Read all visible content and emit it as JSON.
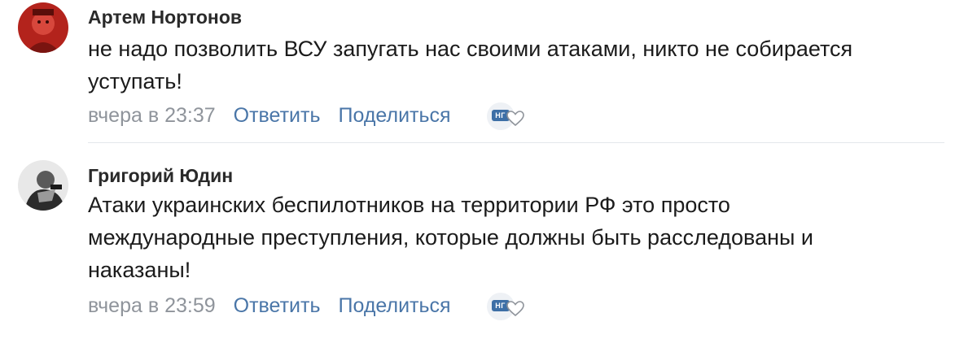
{
  "comments": [
    {
      "author": "Артем Нортонов",
      "text": "не надо позволить ВСУ запугать нас своими атаками, никто не собирается уступать!",
      "time": "вчера в 23:37",
      "reply_label": "Ответить",
      "share_label": "Поделиться",
      "badge_text": "НГ"
    },
    {
      "author": "Григорий Юдин",
      "text": "Атаки украинских беспилотников на территории РФ это просто международные преступления, которые должны быть расследованы и наказаны!",
      "time": "вчера в 23:59",
      "reply_label": "Ответить",
      "share_label": "Поделиться",
      "badge_text": "НГ"
    }
  ],
  "colors": {
    "link": "#4a76a8",
    "meta": "#8f949b",
    "text": "#1b1b1b",
    "badge": "#3d6fa6"
  }
}
